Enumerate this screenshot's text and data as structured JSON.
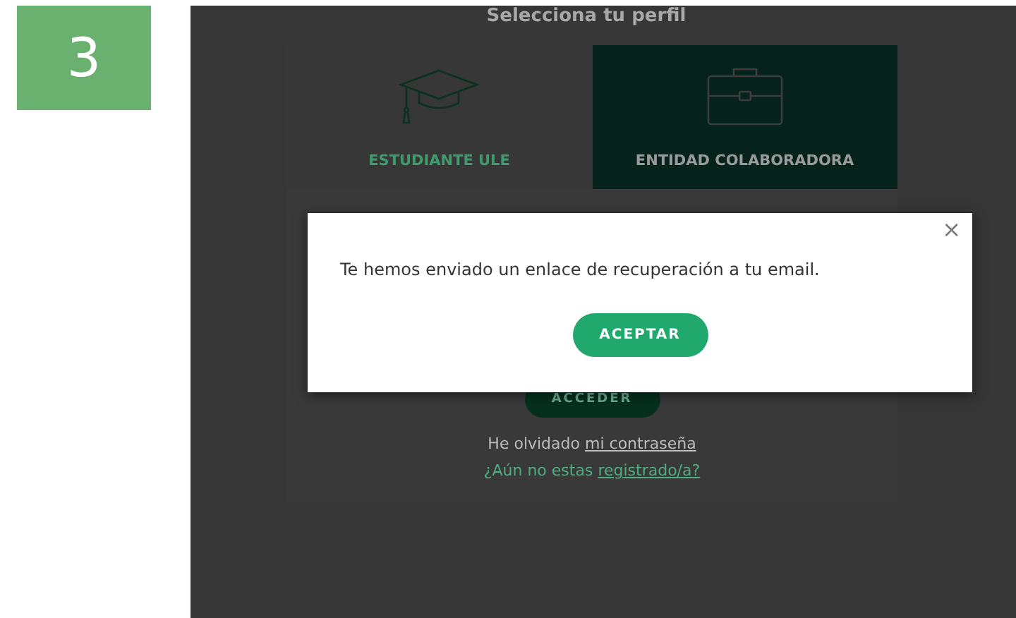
{
  "step": {
    "number": "3"
  },
  "page": {
    "heading": "Selecciona tu perfil"
  },
  "profile_tabs": [
    {
      "label": "ESTUDIANTE ULE",
      "kind": "student",
      "selected": false
    },
    {
      "label": "ENTIDAD COLABORADORA",
      "kind": "company",
      "selected": true
    }
  ],
  "login": {
    "submit": "ACCEDER",
    "lines": [
      {
        "text": "He olvidado",
        "link": "mi contraseña",
        "kind": "plain"
      },
      {
        "text": "¿Aún no estas",
        "link": "registrado/a?",
        "kind": "accent"
      }
    ]
  },
  "dialog": {
    "message": "Te hemos enviado un enlace de recuperación a tu email.",
    "button": "ACEPTAR",
    "close": "×"
  }
}
